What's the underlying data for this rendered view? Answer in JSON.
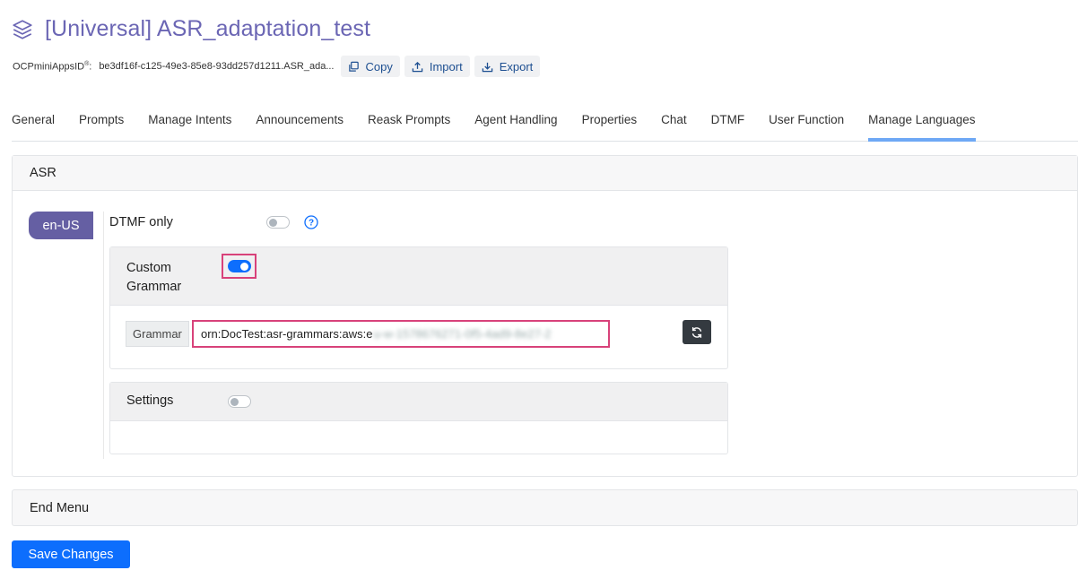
{
  "header": {
    "title": "[Universal] ASR_adaptation_test",
    "icon": "layers-icon"
  },
  "meta": {
    "id_label": "OCPminiAppsID",
    "id_sup": "®",
    "id_suffix": ":",
    "id_value": "be3df16f-c125-49e3-85e8-93dd257d1211.ASR_ada...",
    "copy_label": "Copy",
    "import_label": "Import",
    "export_label": "Export"
  },
  "tabs": [
    {
      "label": "General"
    },
    {
      "label": "Prompts"
    },
    {
      "label": "Manage Intents"
    },
    {
      "label": "Announcements"
    },
    {
      "label": "Reask Prompts"
    },
    {
      "label": "Agent Handling"
    },
    {
      "label": "Properties"
    },
    {
      "label": "Chat"
    },
    {
      "label": "DTMF"
    },
    {
      "label": "User Function"
    },
    {
      "label": "Manage Languages",
      "active": true
    }
  ],
  "asr": {
    "title": "ASR",
    "language": "en-US",
    "dtmf_only_label": "DTMF only",
    "dtmf_only_enabled": false,
    "custom_grammar_label": "Custom Grammar",
    "custom_grammar_enabled": true,
    "grammar_label": "Grammar",
    "grammar_value_visible": "orn:DocTest:asr-grammars:aws:e",
    "grammar_value_obscured": "u-w-1578676271-0f5-4ad9-8e27-2",
    "settings_label": "Settings",
    "settings_enabled": false
  },
  "end_menu": {
    "title": "End Menu"
  },
  "save_label": "Save Changes",
  "colors": {
    "accent": "#6b66b4",
    "primary": "#0d6efd",
    "highlight": "#d8427a",
    "active_tab": "#6ea8f5"
  }
}
